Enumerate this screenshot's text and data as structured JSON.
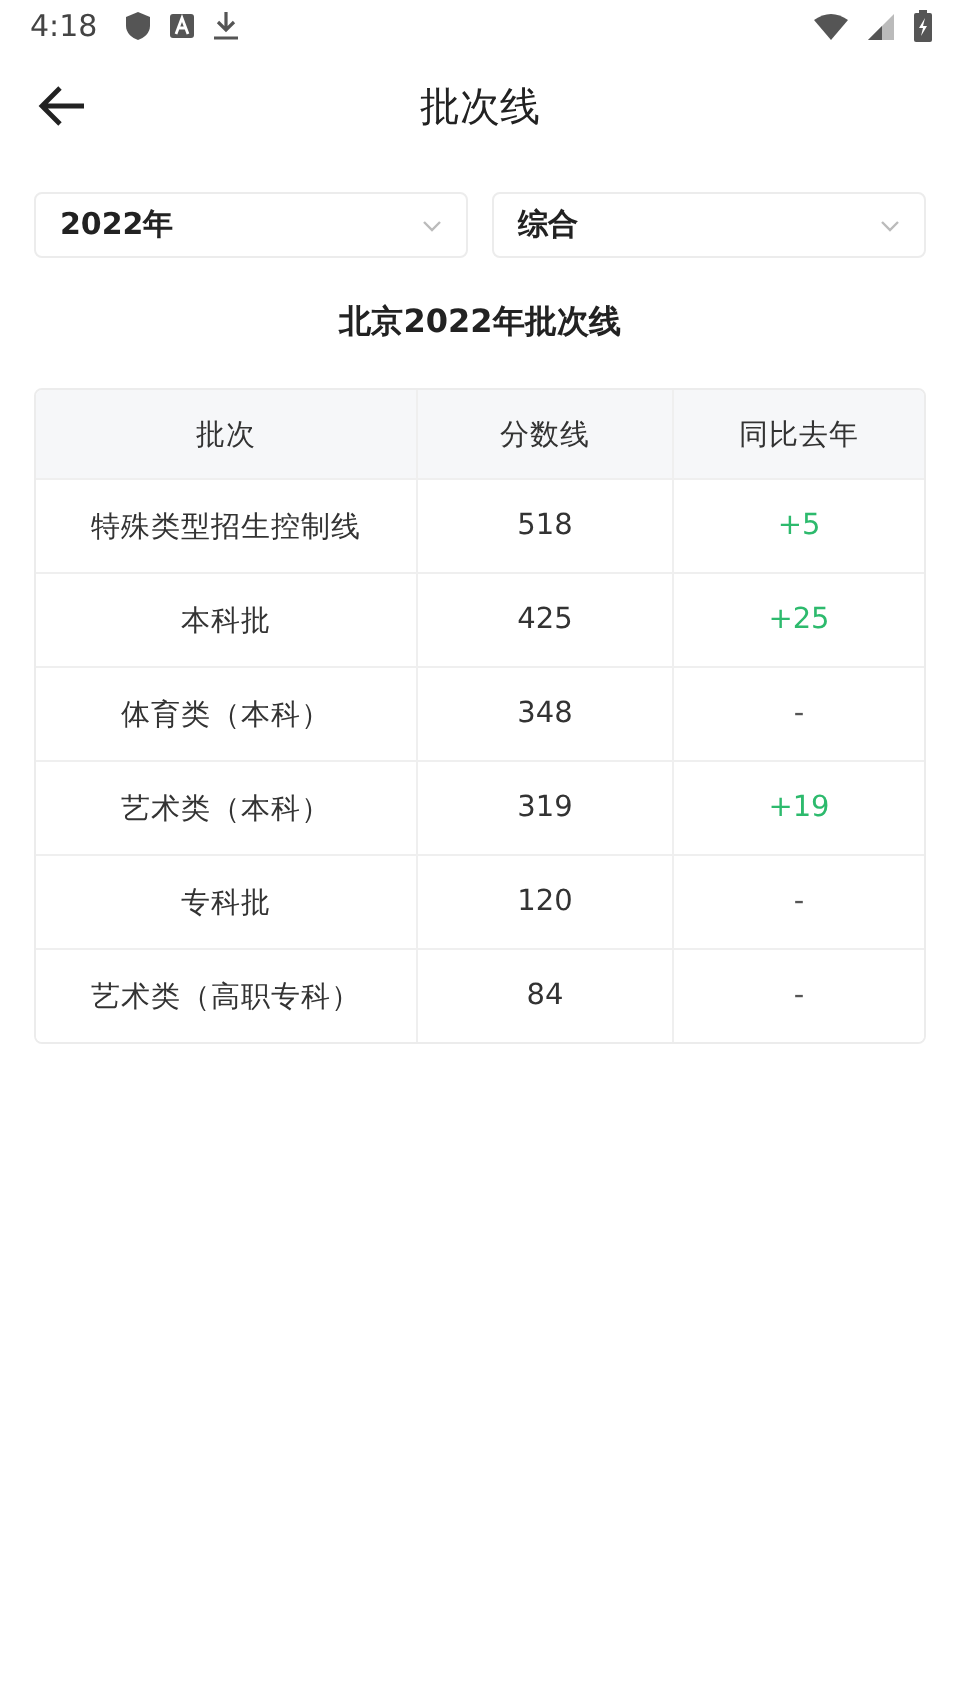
{
  "status_bar": {
    "time": "4:18"
  },
  "header": {
    "title": "批次线"
  },
  "filters": [
    {
      "value": "2022年"
    },
    {
      "value": "综合"
    }
  ],
  "table": {
    "caption": "北京2022年批次线",
    "columns": [
      "批次",
      "分数线",
      "同比去年"
    ],
    "rows": [
      {
        "batch": "特殊类型招生控制线",
        "score": "518",
        "change": "+5",
        "kind": "up"
      },
      {
        "batch": "本科批",
        "score": "425",
        "change": "+25",
        "kind": "up"
      },
      {
        "batch": "体育类（本科）",
        "score": "348",
        "change": "-",
        "kind": "none"
      },
      {
        "batch": "艺术类（本科）",
        "score": "319",
        "change": "+19",
        "kind": "up"
      },
      {
        "batch": "专科批",
        "score": "120",
        "change": "-",
        "kind": "none"
      },
      {
        "batch": "艺术类（高职专科）",
        "score": "84",
        "change": "-",
        "kind": "none"
      }
    ]
  }
}
